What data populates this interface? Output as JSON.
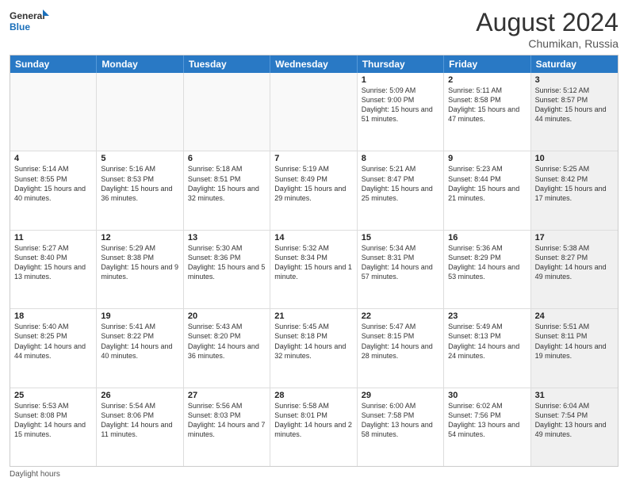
{
  "header": {
    "logo_general": "General",
    "logo_blue": "Blue",
    "month_year": "August 2024",
    "location": "Chumikan, Russia"
  },
  "days_of_week": [
    "Sunday",
    "Monday",
    "Tuesday",
    "Wednesday",
    "Thursday",
    "Friday",
    "Saturday"
  ],
  "footer": {
    "daylight_label": "Daylight hours"
  },
  "weeks": [
    {
      "cells": [
        {
          "empty": true
        },
        {
          "empty": true
        },
        {
          "empty": true
        },
        {
          "empty": true
        },
        {
          "day": "1",
          "sunrise": "Sunrise: 5:09 AM",
          "sunset": "Sunset: 9:00 PM",
          "daylight": "Daylight: 15 hours and 51 minutes."
        },
        {
          "day": "2",
          "sunrise": "Sunrise: 5:11 AM",
          "sunset": "Sunset: 8:58 PM",
          "daylight": "Daylight: 15 hours and 47 minutes."
        },
        {
          "day": "3",
          "shaded": true,
          "sunrise": "Sunrise: 5:12 AM",
          "sunset": "Sunset: 8:57 PM",
          "daylight": "Daylight: 15 hours and 44 minutes."
        }
      ]
    },
    {
      "cells": [
        {
          "day": "4",
          "sunrise": "Sunrise: 5:14 AM",
          "sunset": "Sunset: 8:55 PM",
          "daylight": "Daylight: 15 hours and 40 minutes."
        },
        {
          "day": "5",
          "sunrise": "Sunrise: 5:16 AM",
          "sunset": "Sunset: 8:53 PM",
          "daylight": "Daylight: 15 hours and 36 minutes."
        },
        {
          "day": "6",
          "sunrise": "Sunrise: 5:18 AM",
          "sunset": "Sunset: 8:51 PM",
          "daylight": "Daylight: 15 hours and 32 minutes."
        },
        {
          "day": "7",
          "sunrise": "Sunrise: 5:19 AM",
          "sunset": "Sunset: 8:49 PM",
          "daylight": "Daylight: 15 hours and 29 minutes."
        },
        {
          "day": "8",
          "sunrise": "Sunrise: 5:21 AM",
          "sunset": "Sunset: 8:47 PM",
          "daylight": "Daylight: 15 hours and 25 minutes."
        },
        {
          "day": "9",
          "sunrise": "Sunrise: 5:23 AM",
          "sunset": "Sunset: 8:44 PM",
          "daylight": "Daylight: 15 hours and 21 minutes."
        },
        {
          "day": "10",
          "shaded": true,
          "sunrise": "Sunrise: 5:25 AM",
          "sunset": "Sunset: 8:42 PM",
          "daylight": "Daylight: 15 hours and 17 minutes."
        }
      ]
    },
    {
      "cells": [
        {
          "day": "11",
          "sunrise": "Sunrise: 5:27 AM",
          "sunset": "Sunset: 8:40 PM",
          "daylight": "Daylight: 15 hours and 13 minutes."
        },
        {
          "day": "12",
          "sunrise": "Sunrise: 5:29 AM",
          "sunset": "Sunset: 8:38 PM",
          "daylight": "Daylight: 15 hours and 9 minutes."
        },
        {
          "day": "13",
          "sunrise": "Sunrise: 5:30 AM",
          "sunset": "Sunset: 8:36 PM",
          "daylight": "Daylight: 15 hours and 5 minutes."
        },
        {
          "day": "14",
          "sunrise": "Sunrise: 5:32 AM",
          "sunset": "Sunset: 8:34 PM",
          "daylight": "Daylight: 15 hours and 1 minute."
        },
        {
          "day": "15",
          "sunrise": "Sunrise: 5:34 AM",
          "sunset": "Sunset: 8:31 PM",
          "daylight": "Daylight: 14 hours and 57 minutes."
        },
        {
          "day": "16",
          "sunrise": "Sunrise: 5:36 AM",
          "sunset": "Sunset: 8:29 PM",
          "daylight": "Daylight: 14 hours and 53 minutes."
        },
        {
          "day": "17",
          "shaded": true,
          "sunrise": "Sunrise: 5:38 AM",
          "sunset": "Sunset: 8:27 PM",
          "daylight": "Daylight: 14 hours and 49 minutes."
        }
      ]
    },
    {
      "cells": [
        {
          "day": "18",
          "sunrise": "Sunrise: 5:40 AM",
          "sunset": "Sunset: 8:25 PM",
          "daylight": "Daylight: 14 hours and 44 minutes."
        },
        {
          "day": "19",
          "sunrise": "Sunrise: 5:41 AM",
          "sunset": "Sunset: 8:22 PM",
          "daylight": "Daylight: 14 hours and 40 minutes."
        },
        {
          "day": "20",
          "sunrise": "Sunrise: 5:43 AM",
          "sunset": "Sunset: 8:20 PM",
          "daylight": "Daylight: 14 hours and 36 minutes."
        },
        {
          "day": "21",
          "sunrise": "Sunrise: 5:45 AM",
          "sunset": "Sunset: 8:18 PM",
          "daylight": "Daylight: 14 hours and 32 minutes."
        },
        {
          "day": "22",
          "sunrise": "Sunrise: 5:47 AM",
          "sunset": "Sunset: 8:15 PM",
          "daylight": "Daylight: 14 hours and 28 minutes."
        },
        {
          "day": "23",
          "sunrise": "Sunrise: 5:49 AM",
          "sunset": "Sunset: 8:13 PM",
          "daylight": "Daylight: 14 hours and 24 minutes."
        },
        {
          "day": "24",
          "shaded": true,
          "sunrise": "Sunrise: 5:51 AM",
          "sunset": "Sunset: 8:11 PM",
          "daylight": "Daylight: 14 hours and 19 minutes."
        }
      ]
    },
    {
      "cells": [
        {
          "day": "25",
          "sunrise": "Sunrise: 5:53 AM",
          "sunset": "Sunset: 8:08 PM",
          "daylight": "Daylight: 14 hours and 15 minutes."
        },
        {
          "day": "26",
          "sunrise": "Sunrise: 5:54 AM",
          "sunset": "Sunset: 8:06 PM",
          "daylight": "Daylight: 14 hours and 11 minutes."
        },
        {
          "day": "27",
          "sunrise": "Sunrise: 5:56 AM",
          "sunset": "Sunset: 8:03 PM",
          "daylight": "Daylight: 14 hours and 7 minutes."
        },
        {
          "day": "28",
          "sunrise": "Sunrise: 5:58 AM",
          "sunset": "Sunset: 8:01 PM",
          "daylight": "Daylight: 14 hours and 2 minutes."
        },
        {
          "day": "29",
          "sunrise": "Sunrise: 6:00 AM",
          "sunset": "Sunset: 7:58 PM",
          "daylight": "Daylight: 13 hours and 58 minutes."
        },
        {
          "day": "30",
          "sunrise": "Sunrise: 6:02 AM",
          "sunset": "Sunset: 7:56 PM",
          "daylight": "Daylight: 13 hours and 54 minutes."
        },
        {
          "day": "31",
          "shaded": true,
          "sunrise": "Sunrise: 6:04 AM",
          "sunset": "Sunset: 7:54 PM",
          "daylight": "Daylight: 13 hours and 49 minutes."
        }
      ]
    }
  ]
}
